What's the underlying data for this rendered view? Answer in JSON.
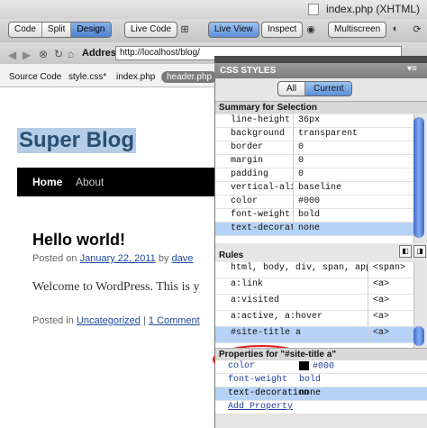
{
  "window": {
    "title": "index.php (XHTML)"
  },
  "toolbar": {
    "view_modes": [
      "Code",
      "Split",
      "Design"
    ],
    "active_view": "Design",
    "live_code": "Live Code",
    "live_view": "Live View",
    "inspect": "Inspect",
    "multiscreen": "Multiscreen"
  },
  "address": {
    "label": "Address:",
    "value": "http://localhost/blog/"
  },
  "file_tabs": [
    "Source Code",
    "style.css*",
    "index.php",
    "header.php"
  ],
  "active_file_tab": "header.php",
  "page": {
    "blog_title": "Super Blog",
    "nav": [
      "Home",
      "About"
    ],
    "post_title": "Hello world!",
    "posted_on": "Posted on",
    "post_date": "January 22, 2011",
    "by": "by",
    "author": "dave",
    "content": "Welcome to WordPress. This is y",
    "posted_in": "Posted in",
    "category": "Uncategorized",
    "separator": "|",
    "comments": "1 Comment"
  },
  "css_panel": {
    "title": "CSS STYLES",
    "tabs": [
      "All",
      "Current"
    ],
    "active_tab": "Current",
    "summary_title": "Summary for Selection",
    "summary": [
      {
        "property": "line-height",
        "value": "36px"
      },
      {
        "property": "background",
        "value": "transparent"
      },
      {
        "property": "border",
        "value": "0"
      },
      {
        "property": "margin",
        "value": "0"
      },
      {
        "property": "padding",
        "value": "0"
      },
      {
        "property": "vertical-align",
        "value": "baseline"
      },
      {
        "property": "color",
        "value": "#000"
      },
      {
        "property": "font-weight",
        "value": "bold"
      },
      {
        "property": "text-decoration",
        "value": "none"
      }
    ],
    "rules_title": "Rules",
    "rules": [
      {
        "selector": "html, body, div, span, applet, obje...",
        "tag": "<span>"
      },
      {
        "selector": "a:link",
        "tag": "<a>"
      },
      {
        "selector": "a:visited",
        "tag": "<a>"
      },
      {
        "selector": "a:active, a:hover",
        "tag": "<a>"
      },
      {
        "selector": "#site-title a",
        "tag": "<a>"
      }
    ],
    "properties_title": "Properties for \"#site-title a\"",
    "properties": [
      {
        "property": "color",
        "value": "#000"
      },
      {
        "property": "font-weight",
        "value": "bold"
      },
      {
        "property": "text-decoration",
        "value": "none"
      }
    ],
    "add_property": "Add Property"
  },
  "colors": {
    "accent": "#5c8fd6",
    "selection": "#b6d3f7",
    "highlight_ring": "#e01b1b",
    "link": "#1e4aa0",
    "blog_title": "#2a4f75"
  }
}
